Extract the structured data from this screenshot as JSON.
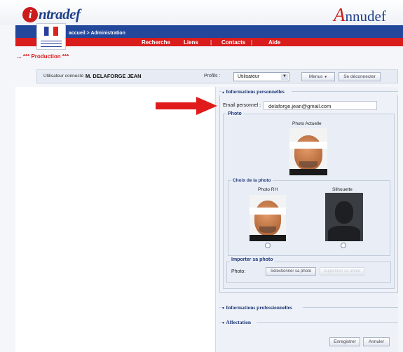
{
  "header": {
    "logo_left_letter": "i",
    "logo_left_rest": "ntradef",
    "logo_right_cap": "A",
    "logo_right_rest": "nnudef"
  },
  "nav": {
    "breadcrumb": "accueil > Administration",
    "items": [
      "Recherche",
      "Liens",
      "Contacts",
      "Aide"
    ],
    "separator": "|",
    "environment": "... *** Production ***"
  },
  "userbar": {
    "connected_label": "Utilisateur connecté :",
    "user_name": "M. DELAFORGE JEAN",
    "profil_label": "Profils :",
    "profil_value": "Utilisateur",
    "menus_label": "Menus",
    "logout_label": "Se déconnecter"
  },
  "perso": {
    "legend": "Informations personnelles",
    "email_label": "Email personnel :",
    "email_value": "delaforge.jean@gmail.com",
    "photo_title": "Photo",
    "photo_actuelle_label": "Photo Actuelle",
    "choix_title": "Choix de la photo",
    "photo_rh_label": "Photo RH",
    "silhouette_label": "Silhouette",
    "import_title": "Importer sa photo",
    "import_photo_label": "Photo:",
    "select_photo_button": "Sélectionner sa photo",
    "delete_photo_button": "Supprimer sa photo"
  },
  "sections": {
    "pro_legend": "Informations professionnelles",
    "affect_legend": "Affectation"
  },
  "actions": {
    "save_label": "Enregistrer",
    "cancel_label": "Annuler"
  },
  "colors": {
    "nav_blue": "#23479b",
    "nav_red": "#d91c1c",
    "arrow_red": "#e11b1b"
  }
}
